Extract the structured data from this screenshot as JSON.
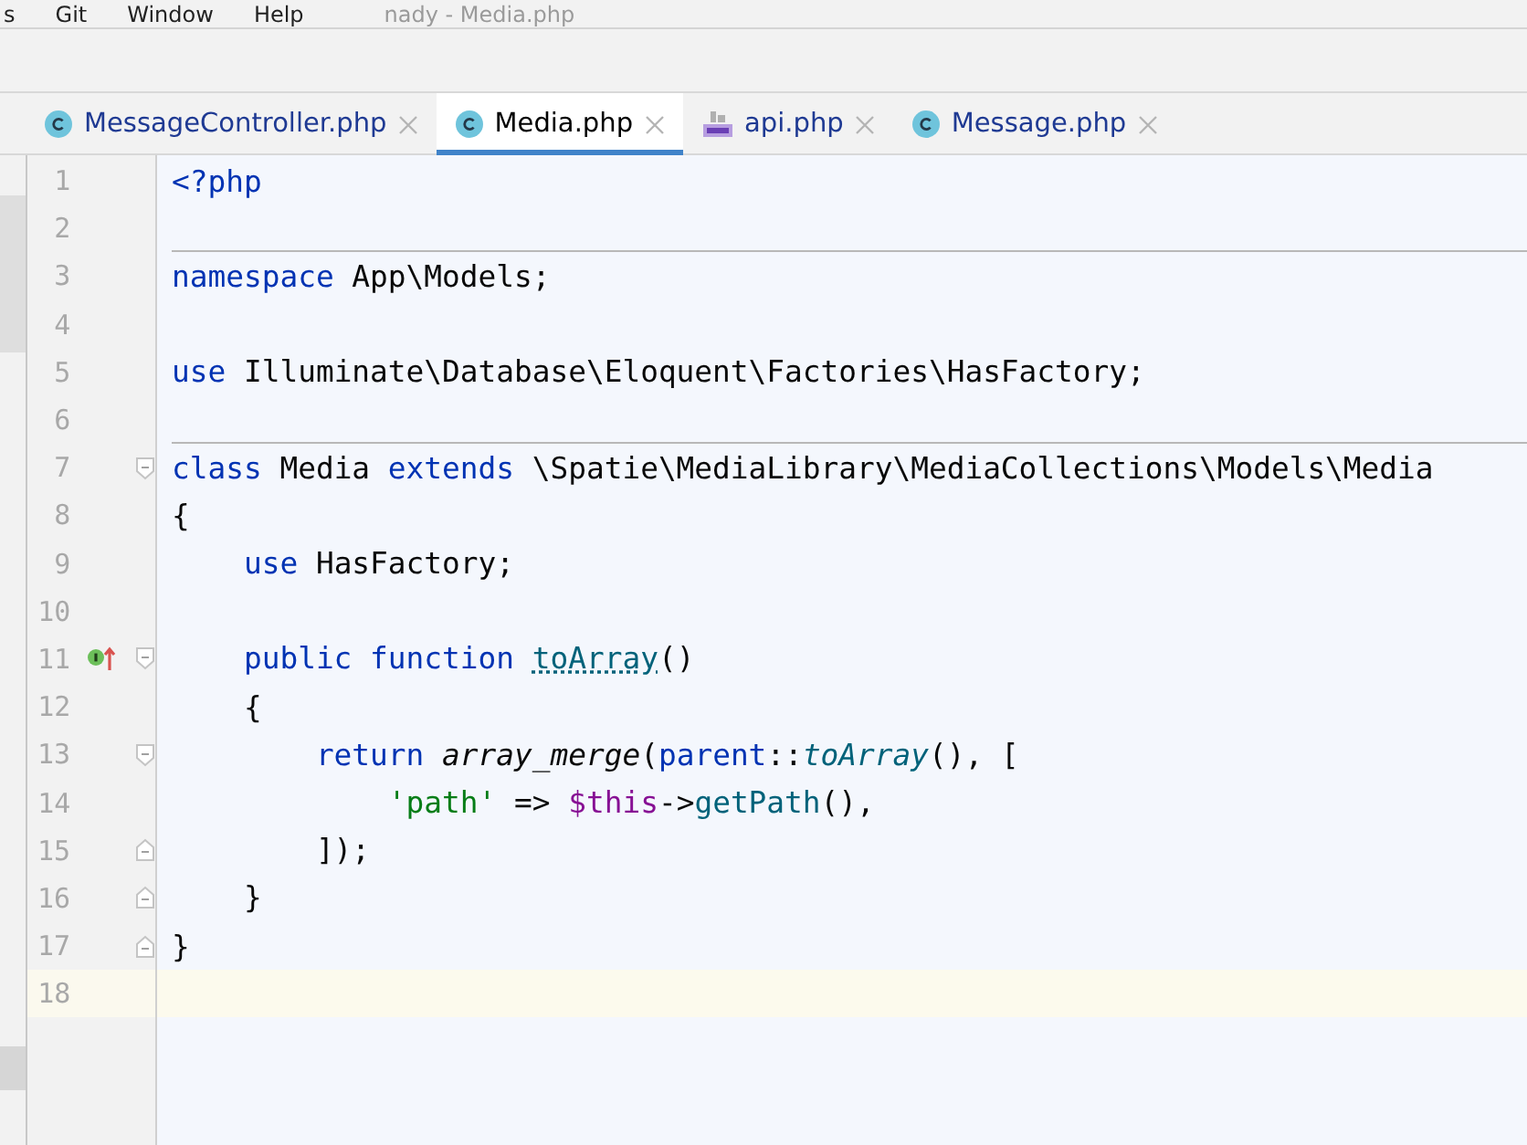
{
  "menu": {
    "items": [
      "s",
      "Git",
      "Window",
      "Help"
    ],
    "title": "nady - Media.php"
  },
  "tabs": [
    {
      "label": "MessageController.php",
      "kind": "class",
      "selected": false
    },
    {
      "label": "Media.php",
      "kind": "class",
      "selected": true
    },
    {
      "label": "api.php",
      "kind": "php",
      "selected": false
    },
    {
      "label": "Message.php",
      "kind": "class",
      "selected": false
    }
  ],
  "editor": {
    "lines": [
      {
        "number": "1",
        "fold_start": false,
        "fold_end": false,
        "tokens": [
          {
            "t": "<?php",
            "kind": "keyword"
          }
        ]
      },
      {
        "number": "2",
        "fold_start": false,
        "fold_end": false,
        "separator": true
      },
      {
        "number": "3",
        "fold_start": false,
        "fold_end": false,
        "tokens": [
          {
            "t": "namespace",
            "kind": "keyword"
          },
          {
            "t": " App\\Models;",
            "kind": "plain"
          }
        ]
      },
      {
        "number": "4",
        "fold_start": false,
        "fold_end": false
      },
      {
        "number": "5",
        "fold_start": false,
        "fold_end": false,
        "tokens": [
          {
            "t": "use",
            "kind": "keyword"
          },
          {
            "t": " Illuminate\\Database\\Eloquent\\Factories\\HasFactory;",
            "kind": "plain"
          }
        ]
      },
      {
        "number": "6",
        "fold_start": false,
        "fold_end": false,
        "separator": true
      },
      {
        "number": "7",
        "fold_start": true,
        "fold_end": false,
        "tokens": [
          {
            "t": "class",
            "kind": "keyword"
          },
          {
            "t": " Media ",
            "kind": "plain"
          },
          {
            "t": "extends",
            "kind": "keyword"
          },
          {
            "t": " \\Spatie\\MediaLibrary\\MediaCollections\\Models\\Media",
            "kind": "plain"
          }
        ]
      },
      {
        "number": "8",
        "fold_start": false,
        "fold_end": false,
        "tokens": [
          {
            "t": "{",
            "kind": "plain"
          }
        ]
      },
      {
        "number": "9",
        "fold_start": false,
        "fold_end": false,
        "tokens": [
          {
            "t": "    use",
            "kind": "keyword"
          },
          {
            "t": " HasFactory;",
            "kind": "plain"
          }
        ]
      },
      {
        "number": "10",
        "fold_start": false,
        "fold_end": false
      },
      {
        "number": "11",
        "fold_start": true,
        "fold_end": false,
        "override": true,
        "tokens": [
          {
            "t": "    public function ",
            "kind": "keyword"
          },
          {
            "t": "toArray",
            "kind": "decl"
          },
          {
            "t": "()",
            "kind": "plain"
          }
        ]
      },
      {
        "number": "12",
        "fold_start": false,
        "fold_end": false,
        "tokens": [
          {
            "t": "    {",
            "kind": "plain"
          }
        ]
      },
      {
        "number": "13",
        "fold_start": true,
        "fold_end": false,
        "tokens": [
          {
            "t": "        return ",
            "kind": "keyword"
          },
          {
            "t": "array_merge",
            "kind": "builtin"
          },
          {
            "t": "(",
            "kind": "plain"
          },
          {
            "t": "parent",
            "kind": "keyword"
          },
          {
            "t": "::",
            "kind": "plain"
          },
          {
            "t": "toArray",
            "kind": "call"
          },
          {
            "t": "(), [",
            "kind": "plain"
          }
        ]
      },
      {
        "number": "14",
        "fold_start": false,
        "fold_end": false,
        "tokens": [
          {
            "t": "            'path'",
            "kind": "string"
          },
          {
            "t": " => ",
            "kind": "plain"
          },
          {
            "t": "$this",
            "kind": "variable"
          },
          {
            "t": "->",
            "kind": "plain"
          },
          {
            "t": "getPath",
            "kind": "method"
          },
          {
            "t": "(),",
            "kind": "plain"
          }
        ]
      },
      {
        "number": "15",
        "fold_start": false,
        "fold_end": true,
        "tokens": [
          {
            "t": "        ]);",
            "kind": "plain"
          }
        ]
      },
      {
        "number": "16",
        "fold_start": false,
        "fold_end": true,
        "tokens": [
          {
            "t": "    }",
            "kind": "plain"
          }
        ]
      },
      {
        "number": "17",
        "fold_start": false,
        "fold_end": true,
        "tokens": [
          {
            "t": "}",
            "kind": "plain"
          }
        ]
      },
      {
        "number": "18",
        "fold_start": false,
        "fold_end": false,
        "current": true
      }
    ]
  }
}
